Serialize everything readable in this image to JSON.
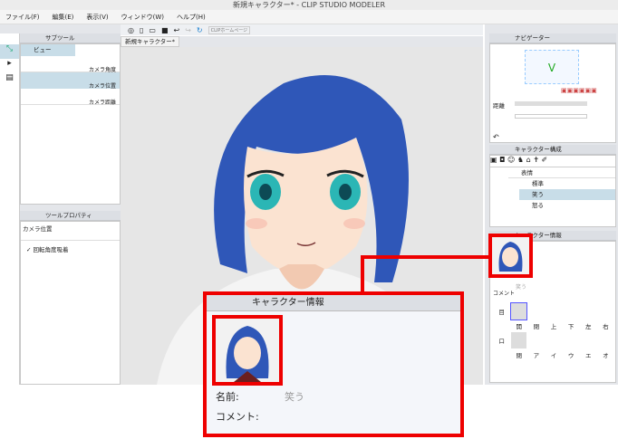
{
  "title": "新規キャラクター* - CLIP STUDIO MODELER",
  "menu": [
    "ファイル(F)",
    "編集(E)",
    "表示(V)",
    "ウィンドウ(W)",
    "ヘルプ(H)"
  ],
  "toolbar": {
    "home_label": "CLIPホームページ"
  },
  "doc_tab": "新規キャラクター*",
  "subtool": {
    "tab": "サブツール",
    "group": "ビュー",
    "items": [
      "カメラ角度",
      "カメラ位置",
      "カメラ距離"
    ],
    "selected": 1
  },
  "toolprop": {
    "tab": "ツールプロパティ",
    "title": "カメラ位置",
    "checkbox": "回転角度吸着",
    "checked": true
  },
  "navigator": {
    "tab": "ナビゲーター",
    "distance_label": "距離"
  },
  "charstruct": {
    "tab": "キャラクター構成",
    "folder": "表情",
    "items": [
      "標準",
      "笑う",
      "怒る"
    ],
    "selected": 1
  },
  "charinfo": {
    "tab": "キャラクター情報",
    "name_label": "名前:",
    "name_value": "笑う",
    "comment_label": "コメント:",
    "comment_short": "コメント",
    "eye_label": "目",
    "eyes": [
      "開",
      "閉",
      "上",
      "下",
      "左",
      "右"
    ],
    "mouth_label": "口",
    "mouth": [
      "閉",
      "ア",
      "イ",
      "ウ",
      "エ",
      "オ"
    ]
  },
  "colors": {
    "accent_red": "#e00000",
    "hair": "#2f57b8"
  }
}
